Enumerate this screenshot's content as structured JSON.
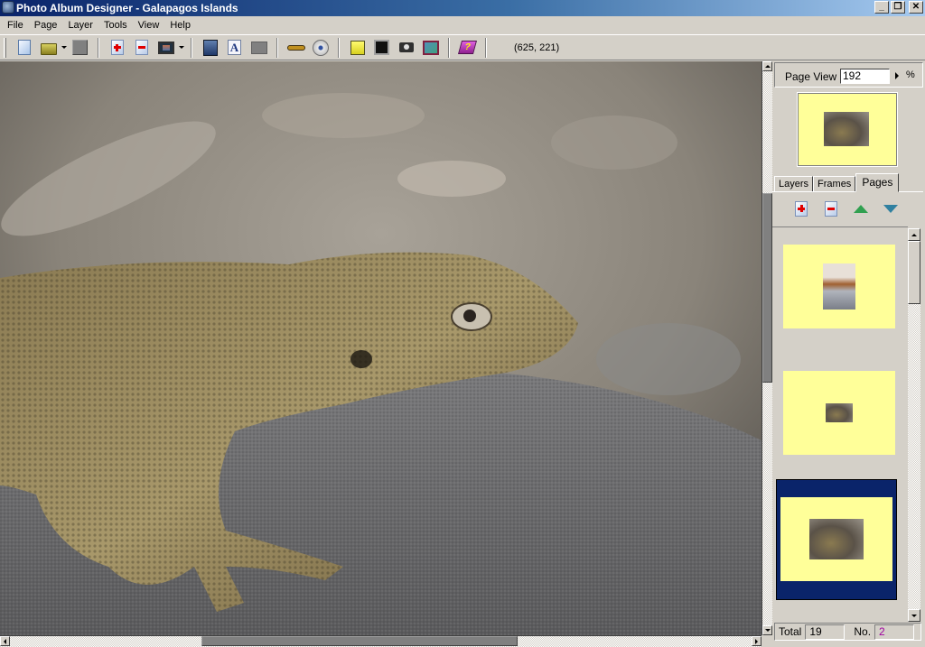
{
  "window": {
    "title": "Photo Album Designer - Galapagos Islands",
    "controls": [
      "minimize",
      "restore",
      "close"
    ]
  },
  "menu": [
    "File",
    "Page",
    "Layer",
    "Tools",
    "View",
    "Help"
  ],
  "toolbar": {
    "buttons": [
      {
        "name": "new-album",
        "icon": "new-document-icon"
      },
      {
        "name": "open-album",
        "icon": "open-folder-icon",
        "dropdown": true
      },
      {
        "name": "save-album",
        "icon": "save-disabled-icon"
      },
      {
        "name": "add-page",
        "icon": "page-add-icon"
      },
      {
        "name": "delete-page",
        "icon": "page-delete-icon"
      },
      {
        "name": "background",
        "icon": "monitor-icon",
        "dropdown": true
      },
      {
        "name": "add-image-frame",
        "icon": "image-frame-icon"
      },
      {
        "name": "add-text",
        "icon": "text-icon"
      },
      {
        "name": "add-shape",
        "icon": "rectangle-icon"
      },
      {
        "name": "settings",
        "icon": "wrench-icon"
      },
      {
        "name": "burn-cd",
        "icon": "cd-icon"
      },
      {
        "name": "export",
        "icon": "box-icon"
      },
      {
        "name": "screensaver",
        "icon": "black-screen-icon"
      },
      {
        "name": "capture",
        "icon": "camera-icon"
      },
      {
        "name": "preview",
        "icon": "gradient-icon"
      },
      {
        "name": "help",
        "icon": "help-book-icon"
      }
    ],
    "coordinates": "(625, 221)"
  },
  "canvas": {
    "image_subject": "Galapagos lava lizard on rock",
    "vscroll_position": 0.4,
    "hscroll_position": 0.27
  },
  "right_panel": {
    "page_view_label": "Page View",
    "page_view_value": "192",
    "page_view_unit": "%",
    "tabs": [
      {
        "label": "Layers",
        "active": false
      },
      {
        "label": "Frames",
        "active": false
      },
      {
        "label": "Pages",
        "active": true
      }
    ],
    "page_tools": [
      {
        "name": "add-page",
        "icon": "page-add-icon"
      },
      {
        "name": "delete-page",
        "icon": "page-delete-icon"
      },
      {
        "name": "move-up",
        "icon": "arrow-up-icon"
      },
      {
        "name": "move-down",
        "icon": "arrow-down-icon"
      }
    ],
    "pages": [
      {
        "index": 1,
        "selected": false,
        "thumb": "portrait"
      },
      {
        "index": 2,
        "selected": false,
        "thumb": "small-landscape"
      },
      {
        "index": 3,
        "selected": true,
        "thumb": "landscape"
      }
    ],
    "status": {
      "total_label": "Total",
      "total_value": "19",
      "no_label": "No.",
      "no_value": "2"
    },
    "colors": {
      "page_bg": "#ffff99",
      "selection": "#0a246a",
      "no_value_color": "#a000a0"
    }
  }
}
